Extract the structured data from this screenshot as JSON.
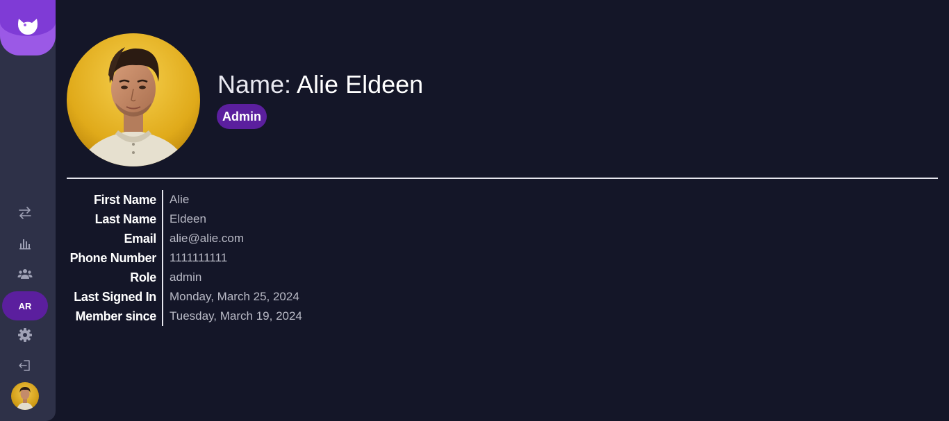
{
  "sidebar": {
    "logo_icon": "cat-logo-icon",
    "nav_icons": [
      "transfer-arrows-icon",
      "bar-chart-icon",
      "users-icon",
      "gear-icon",
      "logout-icon"
    ],
    "language_label": "AR",
    "colors": {
      "sidebar_bg": "#2e3148",
      "logo_purple": "#9b59e6",
      "active_purple": "#5b1f9e"
    }
  },
  "profile": {
    "name_prefix": "Name:",
    "name": "Alie Eldeen",
    "role_badge": "Admin"
  },
  "details": [
    {
      "label": "First Name",
      "value": "Alie"
    },
    {
      "label": "Last Name",
      "value": "Eldeen"
    },
    {
      "label": "Email",
      "value": "alie@alie.com"
    },
    {
      "label": "Phone Number",
      "value": "1111111111"
    },
    {
      "label": "Role",
      "value": "admin"
    },
    {
      "label": "Last Signed In",
      "value": "Monday, March 25, 2024"
    },
    {
      "label": "Member since",
      "value": "Tuesday, March 19, 2024"
    }
  ],
  "colors": {
    "background": "#141628",
    "text": "#ffffff",
    "muted_text": "#b9bac6"
  }
}
